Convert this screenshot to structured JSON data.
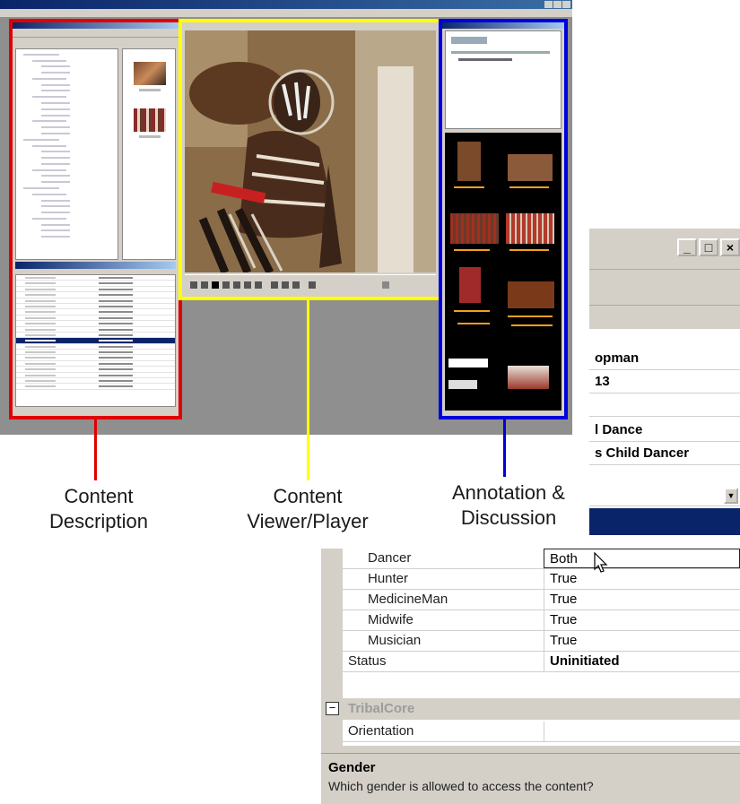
{
  "captions": {
    "content_description": [
      "Content",
      "Description"
    ],
    "content_viewer": [
      "Content",
      "Viewer/Player"
    ],
    "annotation": [
      "Annotation &",
      "Discussion"
    ]
  },
  "colors": {
    "description_box": "#e00000",
    "viewer_box": "#ffff00",
    "annotation_box": "#0000dd"
  },
  "zoom_panel": {
    "window_buttons": [
      "_",
      "□",
      "×"
    ],
    "rows": [
      "opman",
      "13",
      "l Dance",
      "s Child Dancer"
    ]
  },
  "property_grid": {
    "rows": [
      {
        "name": "Dancer",
        "value": "Both",
        "bold": false
      },
      {
        "name": "Hunter",
        "value": "True",
        "bold": false
      },
      {
        "name": "MedicineMan",
        "value": "True",
        "bold": false
      },
      {
        "name": "Midwife",
        "value": "True",
        "bold": false
      },
      {
        "name": "Musician",
        "value": "True",
        "bold": false
      },
      {
        "name": "Status",
        "value": "Uninitiated",
        "bold": true
      }
    ],
    "category": "TribalCore",
    "category_rows": [
      {
        "name": "Orientation",
        "value": ""
      }
    ],
    "description_title": "Gender",
    "description_text": "Which gender is allowed to access the content?"
  }
}
